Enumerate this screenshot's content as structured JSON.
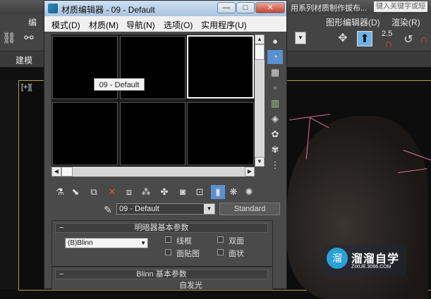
{
  "background_app": {
    "menu_left": "编",
    "menu_right_items": [
      "图形编辑器(D)",
      "渲染(R)"
    ],
    "title_fragment": "用系列材质制作拔布...",
    "search_placeholder": "键入关键字或短语",
    "ribbon_label": "建模",
    "viewport_label": "[+][",
    "toolbar_value": "2.5",
    "pink_accent": "#e0709a"
  },
  "material_editor": {
    "title": "材质编辑器 - 09 - Default",
    "title_buttons": {
      "minimize": "—",
      "maximize": "□",
      "close": "✕"
    },
    "menu": [
      "模式(D)",
      "材质(M)",
      "导航(N)",
      "选项(O)",
      "实用程序(U)"
    ],
    "tooltip": "09 - Default",
    "material_name": "09 - Default",
    "material_type": "Standard",
    "rollout_shader": {
      "header": "明暗器基本参数",
      "shader": "(B)Blinn",
      "options": [
        "线框",
        "双面",
        "面贴图",
        "面状"
      ]
    },
    "rollout_blinn": {
      "header": "Blinn 基本参数",
      "sub": "自发光"
    }
  },
  "watermark": {
    "logo": "溜",
    "title": "溜溜自学",
    "url": "ZIXUE.3066.COM"
  }
}
